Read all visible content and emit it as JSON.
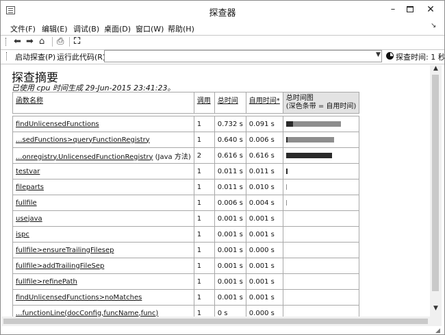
{
  "window": {
    "title": "探查器",
    "min_label": "–",
    "close_label": "✕"
  },
  "menu": [
    "文件(F)",
    "编辑(E)",
    "调试(B)",
    "桌面(D)",
    "窗口(W)",
    "帮助(H)"
  ],
  "toolbar": {
    "icons": [
      "back-arrow-icon",
      "forward-arrow-icon",
      "home-icon",
      "print-icon",
      "find-icon"
    ]
  },
  "profile_bar": {
    "start_label": "启动探查(P)",
    "run_label": "运行此代码(R):",
    "run_value": "",
    "status_label": "探查时间: 1 秒"
  },
  "summary": {
    "title": "探查摘要",
    "subtitle": "已使用 cpu 时间生成 29-Jun-2015 23:41:23。",
    "columns": {
      "function": "函数名称",
      "calls": "调用",
      "total": "总时间",
      "self": "自用时间*",
      "graph": "总时间图",
      "graph_note": "(深色条带 = 自用时间)"
    },
    "rows": [
      {
        "name": "findUnlicensedFunctions",
        "note": "",
        "calls": "1",
        "total": "0.732 s",
        "self": "0.091 s",
        "total_frac": 0.83,
        "self_frac": 0.1
      },
      {
        "name": "...sedFunctions>queryFunctionRegistry",
        "note": "",
        "calls": "1",
        "total": "0.640 s",
        "self": "0.006 s",
        "total_frac": 0.73,
        "self_frac": 0.02
      },
      {
        "name": "...onregistry.UnlicensedFunctionRegistry",
        "note": "(Java 方法)",
        "calls": "2",
        "total": "0.616 s",
        "self": "0.616 s",
        "total_frac": 0.7,
        "self_frac": 0.7
      },
      {
        "name": "testvar",
        "note": "",
        "calls": "1",
        "total": "0.011 s",
        "self": "0.011 s",
        "total_frac": 0.012,
        "self_frac": 0.012
      },
      {
        "name": "fileparts",
        "note": "",
        "calls": "1",
        "total": "0.011 s",
        "self": "0.010 s",
        "total_frac": 0.012,
        "self_frac": 0.0
      },
      {
        "name": "fullfile",
        "note": "",
        "calls": "1",
        "total": "0.006 s",
        "self": "0.004 s",
        "total_frac": 0.008,
        "self_frac": 0.0
      },
      {
        "name": "usejava",
        "note": "",
        "calls": "1",
        "total": "0.001 s",
        "self": "0.001 s",
        "total_frac": 0,
        "self_frac": 0
      },
      {
        "name": "ispc",
        "note": "",
        "calls": "1",
        "total": "0.001 s",
        "self": "0.001 s",
        "total_frac": 0,
        "self_frac": 0
      },
      {
        "name": "fullfile>ensureTrailingFilesep",
        "note": "",
        "calls": "1",
        "total": "0.001 s",
        "self": "0.000 s",
        "total_frac": 0,
        "self_frac": 0
      },
      {
        "name": "fullfile>addTrailingFileSep",
        "note": "",
        "calls": "1",
        "total": "0.001 s",
        "self": "0.001 s",
        "total_frac": 0,
        "self_frac": 0
      },
      {
        "name": "fullfile>refinePath",
        "note": "",
        "calls": "1",
        "total": "0.001 s",
        "self": "0.001 s",
        "total_frac": 0,
        "self_frac": 0
      },
      {
        "name": "findUnlicensedFunctions>noMatches",
        "note": "",
        "calls": "1",
        "total": "0.001 s",
        "self": "0.001 s",
        "total_frac": 0,
        "self_frac": 0
      },
      {
        "name": "...functionLine(docConfig,funcName,func)",
        "note": "",
        "calls": "1",
        "total": "0 s",
        "self": "0.000 s",
        "total_frac": 0,
        "self_frac": 0
      }
    ]
  }
}
